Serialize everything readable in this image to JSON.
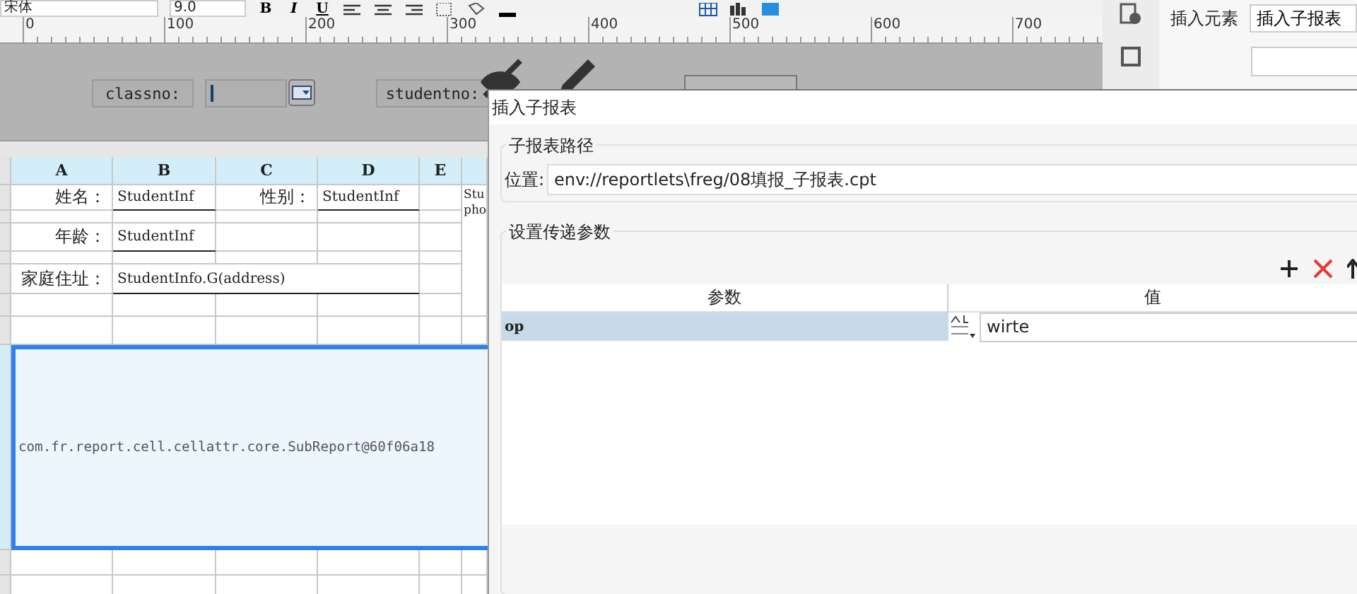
{
  "toolbar": {
    "font": "宋体",
    "size": "9.0",
    "format_buttons": [
      "B",
      "I",
      "U"
    ]
  },
  "ruler": {
    "marks": [
      "0",
      "100",
      "200",
      "300",
      "400",
      "500",
      "600",
      "700"
    ]
  },
  "parameter_panel": {
    "fields": [
      {
        "label": "classno:"
      },
      {
        "label": "studentno:"
      }
    ]
  },
  "right_panel": {
    "label": "插入元素",
    "dropdown": "插入子报表"
  },
  "sheet": {
    "columns": [
      "A",
      "B",
      "C",
      "D",
      "E"
    ],
    "labels": [
      "姓名：",
      "性别：",
      "年龄：",
      "家庭住址："
    ],
    "fields": [
      "StudentInf",
      "StudentInf",
      "StudentInf",
      "StudentInfo.G(address)"
    ],
    "overflow": [
      "Stu",
      "pho"
    ],
    "subreport": {
      "text": "com.fr.report.cell.cellattr.core.SubReport@60f06a18",
      "selected": true
    }
  },
  "dialog": {
    "title": "插入子报表",
    "path_group": "子报表路径",
    "location_label": "位置:",
    "location": "env://reportlets\\freg/08填报_子报表.cpt",
    "params_group": "设置传递参数",
    "columns": [
      "参数",
      "值"
    ],
    "rows": [
      {
        "name": "op",
        "value": "wirte",
        "selected": true
      }
    ]
  }
}
